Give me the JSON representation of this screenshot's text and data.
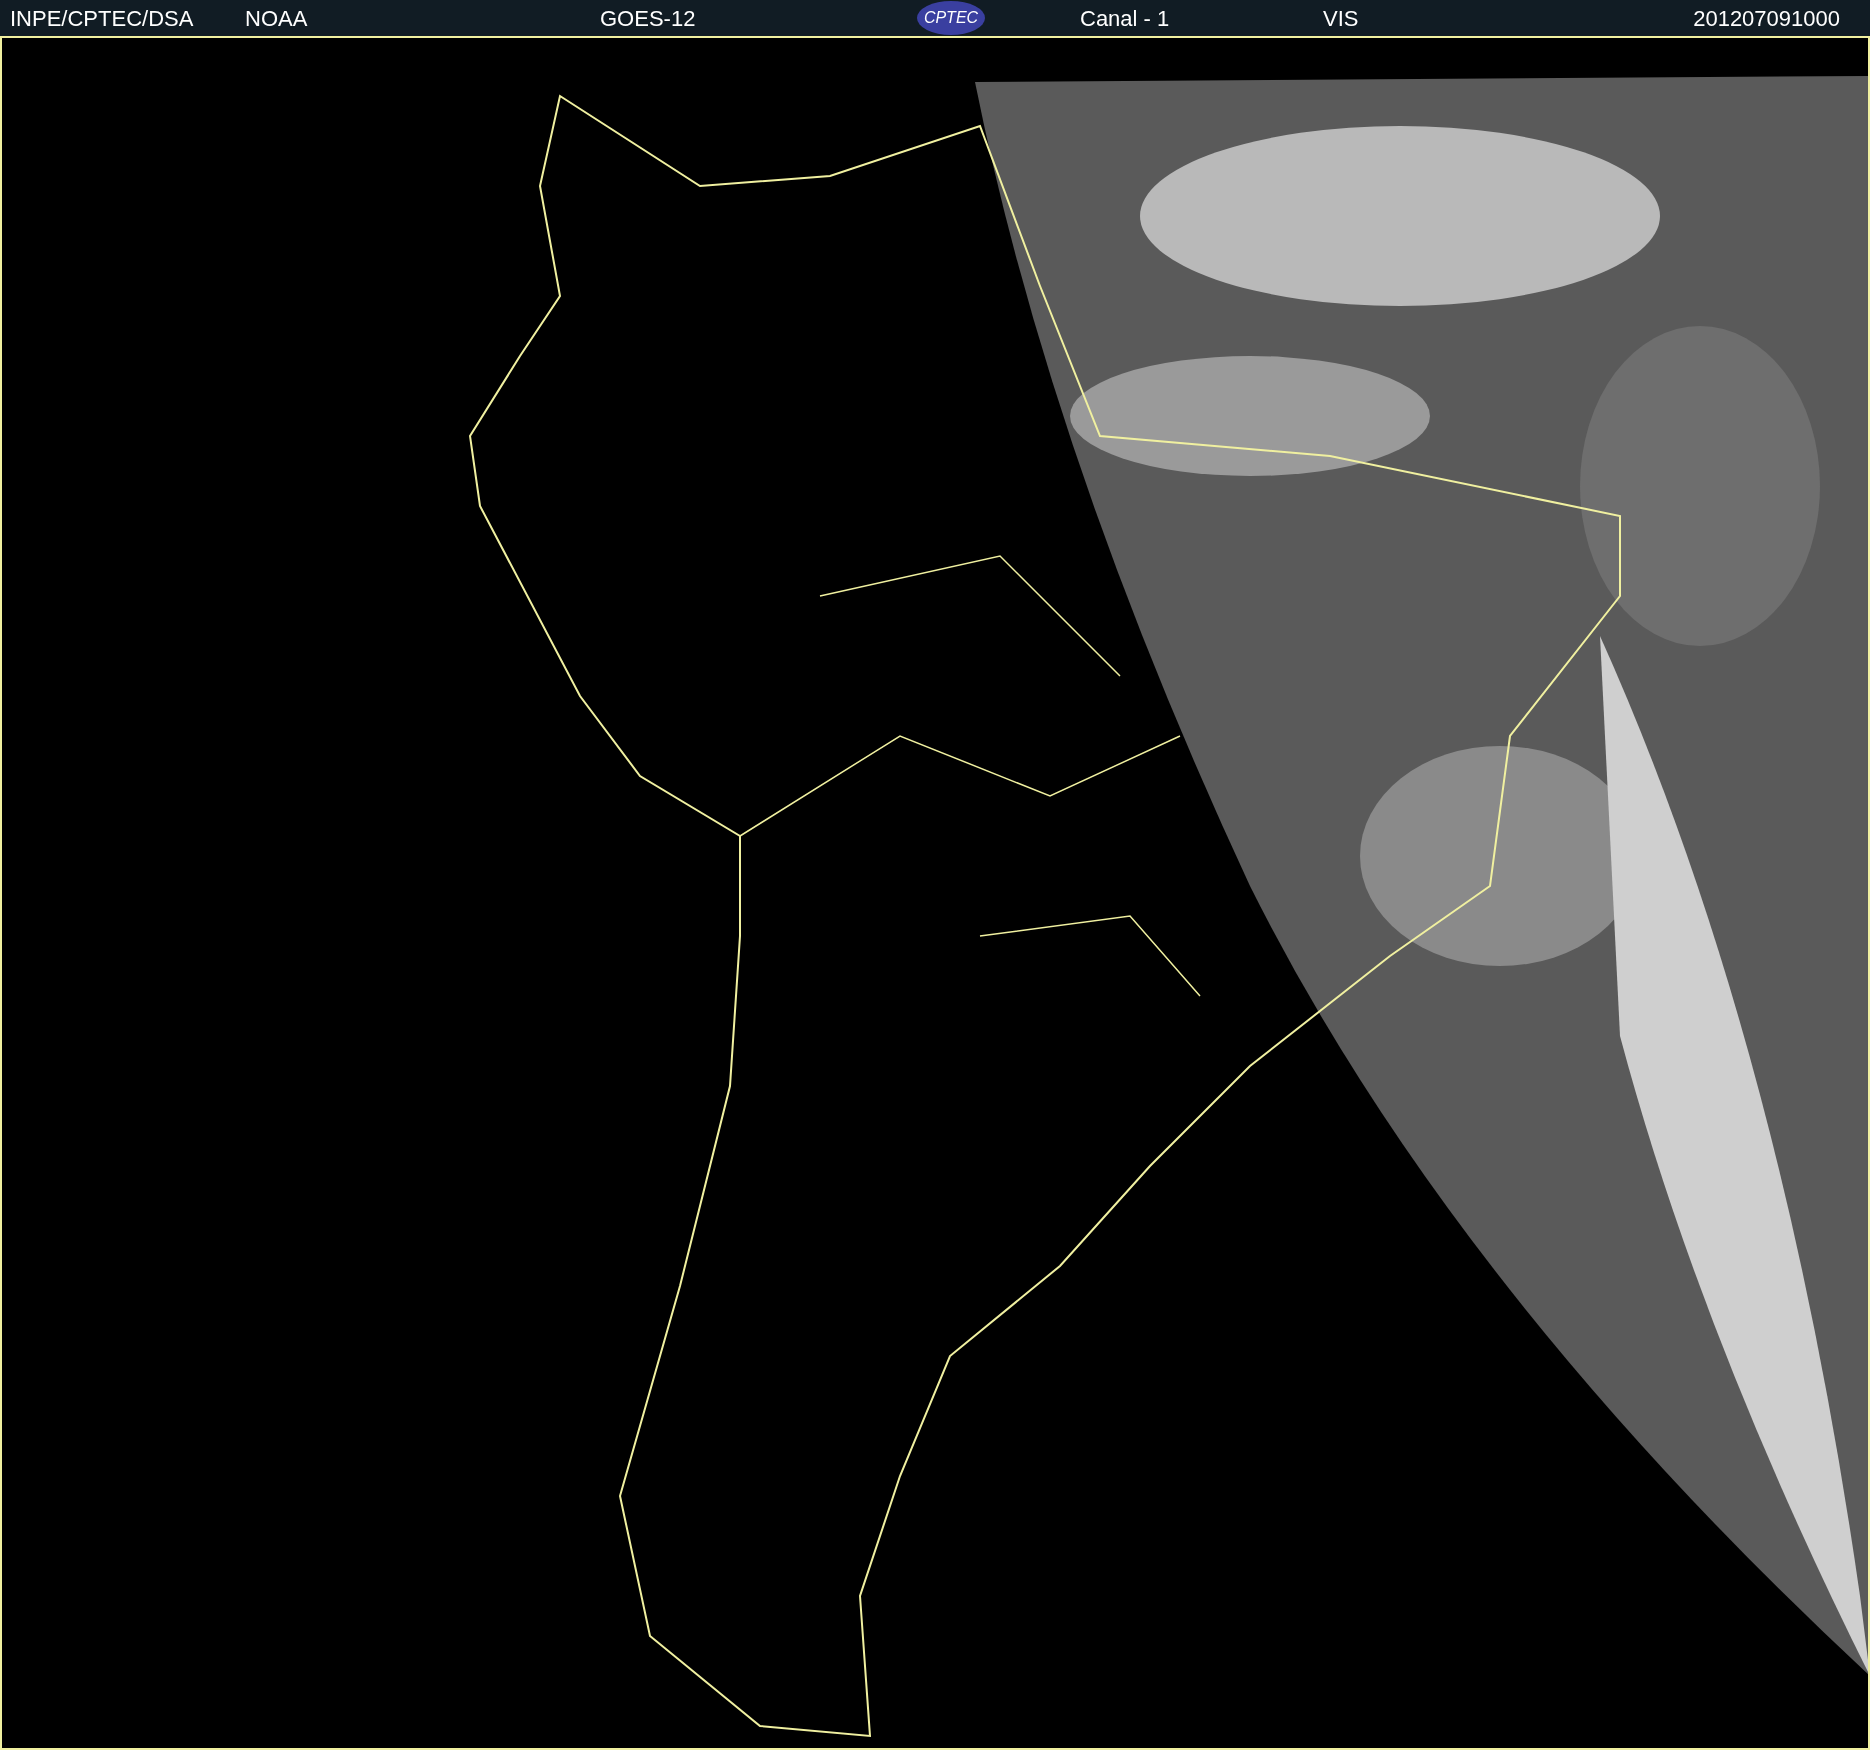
{
  "header": {
    "source": "INPE/CPTEC/DSA",
    "agency": "NOAA",
    "satellite": "GOES-12",
    "logo_text": "CPTEC",
    "channel": "Canal - 1",
    "band": "VIS",
    "timestamp": "201207091000"
  }
}
